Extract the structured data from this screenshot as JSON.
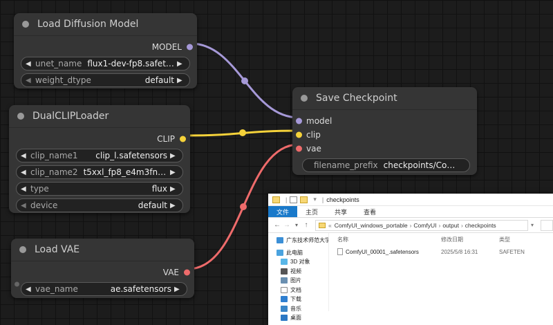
{
  "colors": {
    "model_wire": "#a699d8",
    "clip_wire": "#f5d23a",
    "vae_wire": "#ee6b6b",
    "model_slot": "#a699d8",
    "clip_slot": "#f5d23a",
    "vae_slot": "#ee6b6b",
    "accent_tab": "#1979ca"
  },
  "nodes": {
    "load_diffusion": {
      "title": "Load Diffusion Model",
      "output": "MODEL",
      "widgets": [
        {
          "label": "unet_name",
          "value": "flux1-dev-fp8.safete…"
        },
        {
          "label": "weight_dtype",
          "value": "default"
        }
      ]
    },
    "dual_clip": {
      "title": "DualCLIPLoader",
      "output": "CLIP",
      "widgets": [
        {
          "label": "clip_name1",
          "value": "clip_l.safetensors"
        },
        {
          "label": "clip_name2",
          "value": "t5xxl_fp8_e4m3fn.s…"
        },
        {
          "label": "type",
          "value": "flux"
        },
        {
          "label": "device",
          "value": "default"
        }
      ]
    },
    "load_vae": {
      "title": "Load VAE",
      "output": "VAE",
      "widgets": [
        {
          "label": "vae_name",
          "value": "ae.safetensors"
        }
      ]
    },
    "save_checkpoint": {
      "title": "Save Checkpoint",
      "inputs": [
        "model",
        "clip",
        "vae"
      ],
      "widgets": [
        {
          "label": "filename_prefix",
          "value": "checkpoints/ComfyUI"
        }
      ]
    }
  },
  "explorer": {
    "title": "checkpoints",
    "tabs": [
      "文件",
      "主页",
      "共享",
      "查看"
    ],
    "breadcrumb": [
      "ComfyUI_windows_portable",
      "ComfyUI",
      "output",
      "checkpoints"
    ],
    "breadcrumb_prefix": "«",
    "sidebar": [
      {
        "label": "广东技术师范大学",
        "icon": "cloud-icon"
      },
      {
        "label": "此电脑",
        "icon": "pc-icon"
      },
      {
        "label": "3D 对象",
        "icon": "cube-icon"
      },
      {
        "label": "视频",
        "icon": "video-icon"
      },
      {
        "label": "图片",
        "icon": "image-icon"
      },
      {
        "label": "文档",
        "icon": "document-icon"
      },
      {
        "label": "下载",
        "icon": "download-icon"
      },
      {
        "label": "音乐",
        "icon": "music-icon"
      },
      {
        "label": "桌面",
        "icon": "desktop-icon"
      }
    ],
    "columns": [
      "名称",
      "修改日期",
      "类型"
    ],
    "files": [
      {
        "name": "ComfyUI_00001_.safetensors",
        "date": "2025/5/8 16:31",
        "type": "SAFETEN"
      }
    ]
  }
}
